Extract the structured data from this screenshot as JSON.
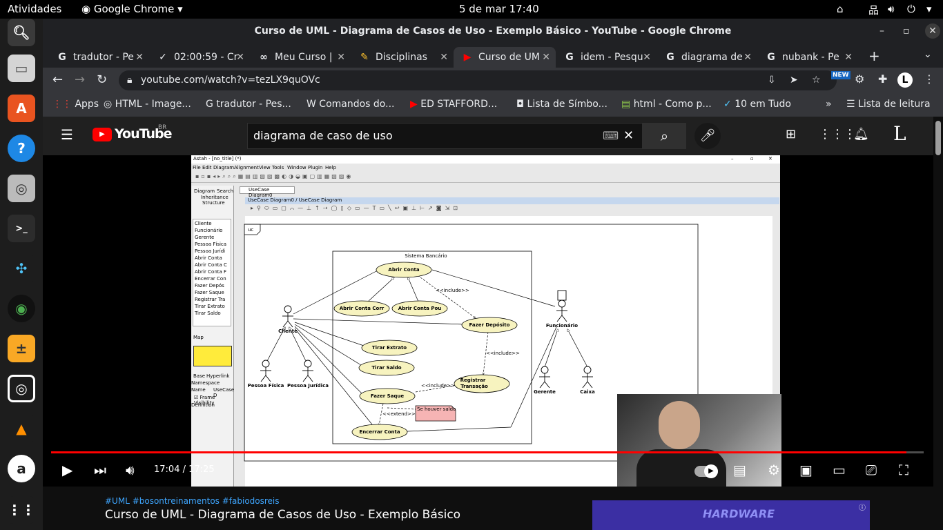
{
  "system_bar": {
    "activities": "Atividades",
    "app": "Google Chrome",
    "clock": "5 de mar  17:40"
  },
  "dock": [
    {
      "name": "Activities"
    },
    {
      "name": "Files"
    },
    {
      "name": "App Center"
    },
    {
      "name": "Help"
    },
    {
      "name": "Screenshot"
    },
    {
      "name": "Terminal"
    },
    {
      "name": "Puzzle"
    },
    {
      "name": "Camera"
    },
    {
      "name": "Calculator"
    },
    {
      "name": "Webcam"
    },
    {
      "name": "VLC"
    },
    {
      "name": "Amazon"
    },
    {
      "name": "Show apps"
    }
  ],
  "window": {
    "title": "Curso de UML - Diagrama de Casos de Uso - Exemplo Básico - YouTube - Google Chrome"
  },
  "tabs": [
    {
      "icon": "G",
      "label": "tradutor - Pe"
    },
    {
      "icon": "✓",
      "label": "02:00:59 - Cr"
    },
    {
      "icon": "∞",
      "label": "Meu Curso |"
    },
    {
      "icon": "✎",
      "label": "Disciplinas"
    },
    {
      "icon": "▶",
      "label": "Curso de UM"
    },
    {
      "icon": "G",
      "label": "idem - Pesqu"
    },
    {
      "icon": "G",
      "label": "diagrama de"
    },
    {
      "icon": "G",
      "label": "nubank - Pe"
    }
  ],
  "address": {
    "url": "youtube.com/watch?v=tezLX9quOVc"
  },
  "bookmarks": [
    {
      "icon": "⋮⋮",
      "label": "Apps"
    },
    {
      "icon": "◎",
      "label": "HTML - Image..."
    },
    {
      "icon": "G",
      "label": "tradutor - Pes..."
    },
    {
      "icon": "W",
      "label": "Comandos do..."
    },
    {
      "icon": "▶",
      "label": "ED STAFFORD..."
    },
    {
      "icon": "◘",
      "label": "Lista de Símbo..."
    },
    {
      "icon": "▤",
      "label": "html - Como p..."
    },
    {
      "icon": "✓",
      "label": "10 em Tudo"
    },
    {
      "icon": "»",
      "label": ""
    },
    {
      "icon": "☰",
      "label": "Lista de leitura"
    }
  ],
  "youtube": {
    "brand": "YouTube",
    "region": "BR",
    "search_value": "diagrama de caso de uso",
    "time_current": "17:04",
    "time_sep": " / ",
    "time_total": "17:25",
    "progress": 0.98,
    "hashtags": "#UML #bosontreinamentos #fabiodosreis",
    "video_title": "Curso de UML - Diagrama de Casos de Uso - Exemplo Básico",
    "ad_text": "HARDWARE"
  },
  "astah": {
    "title": "Astah - [no_title] (*)",
    "menu": [
      "File",
      "Edit",
      "Diagram",
      "Alignment",
      "View",
      "Tools",
      "Window",
      "Plugin",
      "Help"
    ],
    "side_tabs": [
      "Diagram",
      "Search",
      "Inheritance",
      "Structure"
    ],
    "tree": [
      "Cliente",
      "Funcionário",
      "Gerente",
      "Pessoa Física",
      "Pessoa Jurídi",
      "Abrir Conta",
      "Abrir Conta C",
      "Abrir Conta F",
      "Encerrar Con",
      "Fazer Depós",
      "Fazer Saque",
      "Registrar Tra",
      "Tirar Extrato",
      "Tirar Saldo"
    ],
    "map_label": "Map",
    "prop_tabs": [
      "Base",
      "Hyperlink"
    ],
    "props": {
      "ns": "Namespace",
      "name_key": "Name",
      "name_val": "UseCase D",
      "frame": "Frame Visibility",
      "def": "Definition"
    },
    "diagram_tab": "UseCase Diagram0",
    "breadcrumb": "UseCase Diagram0 / UseCase Diagram",
    "uc": "uc",
    "boundary": "Sistema Bancário",
    "usecases": {
      "abrir": "Abrir Conta",
      "corr": "Abrir Conta Corr",
      "pou": "Abrir Conta Pou",
      "dep": "Fazer Depósito",
      "ext": "Tirar Extrato",
      "sal": "Tirar Saldo",
      "saq": "Fazer Saque",
      "reg1": "Registrar",
      "reg2": "Transação",
      "enc": "Encerrar Conta"
    },
    "actors": {
      "cliente": "Cliente",
      "func": "Funcionário",
      "pf": "Pessoa Física",
      "pj": "Pessoa Jurídica",
      "ger": "Gerente",
      "cx": "Caixa"
    },
    "stereo": {
      "inc": "<<include>>",
      "ext": "<<extend>>"
    },
    "note": "Se houver saldo"
  }
}
